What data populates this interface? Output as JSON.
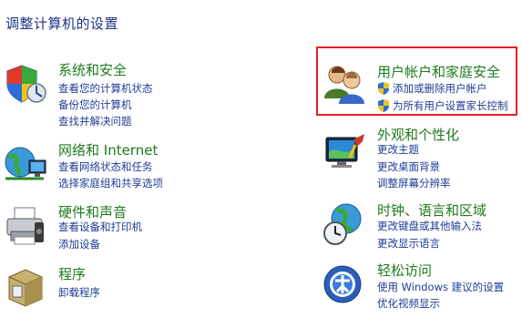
{
  "page": {
    "title": "调整计算机的设置"
  },
  "categories": {
    "system": {
      "title": "系统和安全",
      "icon": "shield-system-icon",
      "links": [
        "查看您的计算机状态",
        "备份您的计算机",
        "查找并解决问题"
      ]
    },
    "users": {
      "title": "用户帐户和家庭安全",
      "icon": "users-icon",
      "links": [
        "添加或删除用户帐户",
        "为所有用户设置家长控制"
      ]
    },
    "network": {
      "title": "网络和 Internet",
      "icon": "network-globe-icon",
      "links": [
        "查看网络状态和任务",
        "选择家庭组和共享选项"
      ]
    },
    "appearance": {
      "title": "外观和个性化",
      "icon": "monitor-paint-icon",
      "links": [
        "更改主题",
        "更改桌面背景",
        "调整屏幕分辨率"
      ]
    },
    "hardware": {
      "title": "硬件和声音",
      "icon": "printer-icon",
      "links": [
        "查看设备和打印机",
        "添加设备"
      ]
    },
    "clock": {
      "title": "时钟、语言和区域",
      "icon": "clock-globe-icon",
      "links": [
        "更改键盘或其他输入法",
        "更改显示语言"
      ]
    },
    "programs": {
      "title": "程序",
      "icon": "programs-box-icon",
      "links": [
        "卸载程序"
      ]
    },
    "ease": {
      "title": "轻松访问",
      "icon": "ease-of-access-icon",
      "links": [
        "使用 Windows 建议的设置",
        "优化视频显示"
      ]
    }
  },
  "colors": {
    "title": "#1e3287",
    "category": "#1e7a1e",
    "link": "#1e3d96",
    "highlight": "#e0202a"
  }
}
